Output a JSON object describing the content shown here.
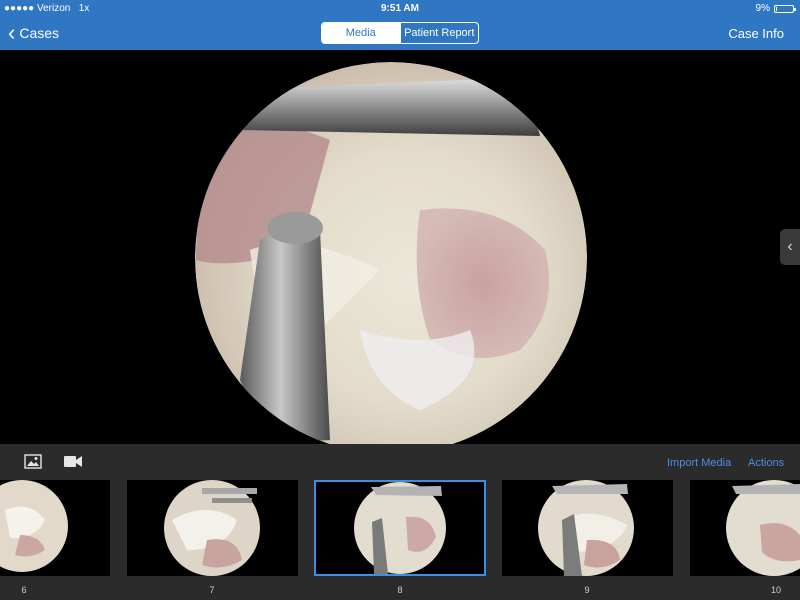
{
  "status": {
    "carrier": "●●●●● Verizon",
    "extra": "1x",
    "time": "9:51 AM",
    "battery_text": "9%",
    "battery_level": 0.09
  },
  "nav": {
    "back_label": "Cases",
    "segments": [
      "Media",
      "Patient Report"
    ],
    "case_info": "Case Info"
  },
  "colors": {
    "nav_blue": "#2f76c3",
    "accent": "#4a90e2",
    "panel": "#2b2b2b"
  },
  "toolbar": {
    "photo_icon": "photo-icon",
    "video_icon": "video-camera-icon",
    "import_label": "Import Media",
    "actions_label": "Actions"
  },
  "thumbnails": {
    "numbers": [
      "6",
      "7",
      "8",
      "9",
      "10"
    ],
    "selected": "8"
  }
}
